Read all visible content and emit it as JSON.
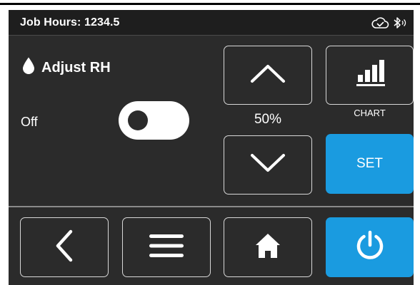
{
  "status_bar": {
    "job_hours": "Job Hours: 1234.5",
    "icons": [
      "cloud-check-icon",
      "bluetooth-icon"
    ]
  },
  "control": {
    "title": "Adjust RH",
    "title_icon": "water-drop-icon",
    "toggle_label": "Off",
    "toggle_on": false,
    "setpoint": "50%",
    "chart_label": "CHART",
    "set_label": "SET"
  },
  "nav": {
    "icons": [
      "back-arrow-icon",
      "menu-icon",
      "home-icon",
      "power-icon"
    ]
  },
  "colors": {
    "background": "#2b2b2b",
    "status_bar": "#1e1e1e",
    "accent": "#1a9be0",
    "border": "#d8d8d8",
    "text": "#ffffff"
  }
}
